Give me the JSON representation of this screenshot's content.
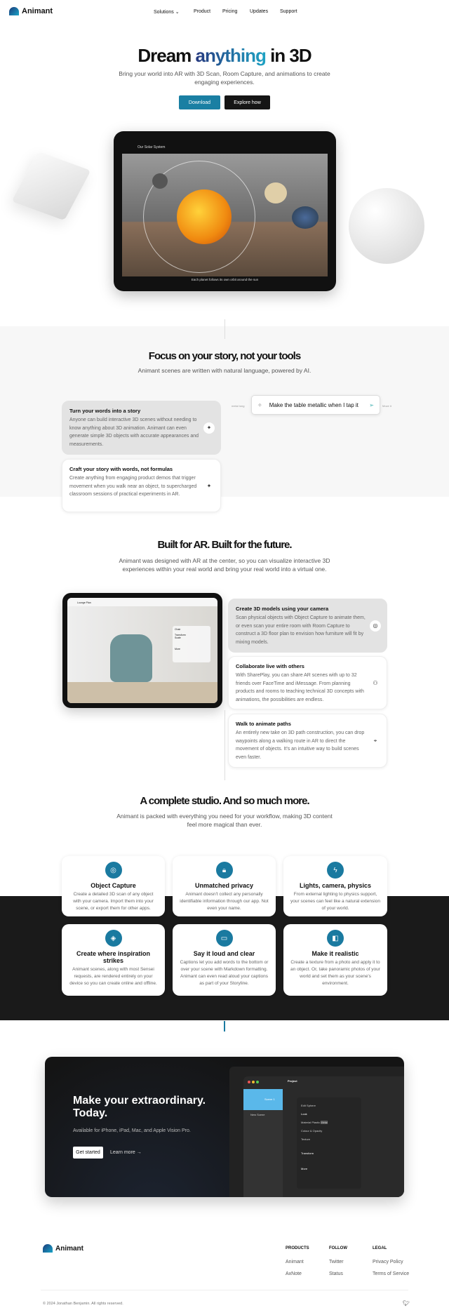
{
  "nav": {
    "brand": "Animant",
    "items": [
      "Solutions",
      "Product",
      "Pricing",
      "Updates",
      "Support"
    ]
  },
  "hero": {
    "title_pre": "Dream ",
    "title_accent": "anything",
    "title_post": " in 3D",
    "subtitle": "Bring your world into AR with 3D Scan, Room Capture, and animations to create engaging experiences.",
    "download": "Download",
    "explore": "Explore how",
    "tablet": {
      "title": "Our Solar System",
      "caption": "Each planet follows its own orbit around the sun"
    }
  },
  "story": {
    "title": "Focus on your story, not your tools",
    "subtitle": "Animant scenes are written with natural language, powered by AI.",
    "prompt": "Make the table metallic when I tap it",
    "prompt_left": "metal long",
    "prompt_right": "Move it",
    "cards": [
      {
        "title": "Turn your words into a story",
        "text": "Anyone can build interactive 3D scenes without needing to know anything about 3D animation. Animant can even generate simple 3D objects with accurate appearances and measurements.",
        "icon": "sparkles-icon",
        "glyph": "✦"
      },
      {
        "title": "Craft your story with words, not formulas",
        "text": "Create anything from engaging product demos that trigger movement when you walk near an object, to supercharged classroom sessions of practical experiments in AR.",
        "icon": "sparkle-icon",
        "glyph": "✦"
      }
    ]
  },
  "ar": {
    "title": "Built for AR. Built for the future.",
    "subtitle": "Animant was designed with AR at the center, so you can visualize interactive 3D experiences within your real world and bring your real world into a virtual one.",
    "tablet": {
      "title": "Lounge Plan",
      "panel_title": "Chair",
      "transform": "Transform",
      "scale": "Scale",
      "more": "More"
    },
    "cards": [
      {
        "title": "Create 3D models using your camera",
        "text": "Scan physical objects with Object Capture to animate them, or even scan your entire room with Room Capture to construct a 3D floor plan to envision how furniture will fit by mixing models.",
        "icon": "camera-icon",
        "glyph": "◎"
      },
      {
        "title": "Collaborate live with others",
        "text": "With SharePlay, you can share AR scenes with up to 32 friends over FaceTime and iMessage. From planning products and rooms to teaching technical 3D concepts with animations, the possibilities are endless.",
        "icon": "shareplay-icon",
        "glyph": "⚇"
      },
      {
        "title": "Walk to animate paths",
        "text": "An entirely new take on 3D path construction, you can drop waypoints along a walking route in AR to direct the movement of objects. It's an intuitive way to build scenes even faster.",
        "icon": "location-pin-icon",
        "glyph": "⌖"
      }
    ]
  },
  "studio": {
    "title": "A complete studio. And so much more.",
    "subtitle": "Animant is packed with everything you need for your workflow, making 3D content feel more magical than ever.",
    "features": [
      {
        "title": "Object Capture",
        "text": "Create a detailed 3D scan of any object with your camera. Import them into your scene, or export them for other apps.",
        "icon": "camera-icon",
        "glyph": "◎"
      },
      {
        "title": "Unmatched privacy",
        "text": "Animant doesn't collect any personally identifiable information through our app. Not even your name.",
        "icon": "lock-icon",
        "glyph": "🔒︎"
      },
      {
        "title": "Lights, camera, physics",
        "text": "From external lighting to physics support, your scenes can feel like a natural extension of your world.",
        "icon": "bolt-icon",
        "glyph": "ϟ"
      },
      {
        "title": "Create where inspiration strikes",
        "text": "Animant scenes, along with most Sensei requests, are rendered entirely on your device so you can create online and offline.",
        "icon": "device-icon",
        "glyph": "◈"
      },
      {
        "title": "Say it loud and clear",
        "text": "Captions let you add words to the bottom or over your scene with Markdown formatting. Animant can even read aloud your captions as part of your Storyline.",
        "icon": "caption-icon",
        "glyph": "▭"
      },
      {
        "title": "Make it realistic",
        "text": "Create a texture from a photo and apply it to an object. Or, take panoramic photos of your world and set them as your scene's environment.",
        "icon": "texture-icon",
        "glyph": "◧"
      }
    ]
  },
  "cta": {
    "title": "Make your extraordinary. Today.",
    "subtitle": "Available for iPhone, iPad, Mac, and Apple Vision Pro.",
    "primary": "Get started",
    "secondary": "Learn more →",
    "app": {
      "project": "Project",
      "scene": "Scene 1",
      "new_scene": "New Scene",
      "edit": "Edit",
      "object": "Sphere",
      "look": "Look",
      "material": "Material",
      "plastic": "Plastic",
      "metal": "Metal",
      "colour": "Colour & Opacity",
      "texture": "Texture",
      "transform": "Transform",
      "more": "More"
    }
  },
  "footer": {
    "brand": "Animant",
    "columns": [
      {
        "heading": "PRODUCTS",
        "links": [
          "Animant",
          "AxNote"
        ]
      },
      {
        "heading": "FOLLOW",
        "links": [
          "Twitter",
          "Status"
        ]
      },
      {
        "heading": "LEGAL",
        "links": [
          "Privacy Policy",
          "Terms of Service"
        ]
      }
    ],
    "copyright": "© 2024 Jonathan Benjamin. All rights reserved."
  },
  "colors": {
    "accent": "#1a7aa0",
    "dark": "#1a1a1a",
    "title_gradient": [
      "#263a80",
      "#1fa3c4"
    ]
  }
}
